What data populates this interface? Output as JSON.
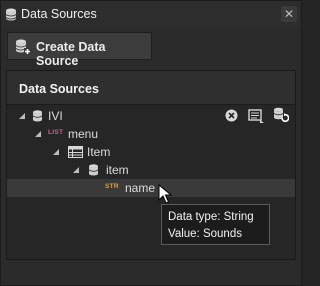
{
  "window": {
    "title": "Data Sources",
    "close_glyph": "✕"
  },
  "toolbar": {
    "create_label": "Create Data Source",
    "create_icon": "database-add-icon"
  },
  "panel": {
    "header": "Data Sources",
    "tree": [
      {
        "label": "IVI",
        "tag": "",
        "icon": "database-icon",
        "depth": 0
      },
      {
        "label": "menu",
        "tag": "LIST",
        "icon": "list-icon",
        "depth": 1
      },
      {
        "label": "Item",
        "tag": "",
        "icon": "table-icon",
        "depth": 2
      },
      {
        "label": "item",
        "tag": "",
        "icon": "database-icon",
        "depth": 3
      },
      {
        "label": "name",
        "tag": "STR",
        "icon": "string-icon",
        "depth": 4,
        "selected": true
      }
    ],
    "row_actions": [
      "remove-icon",
      "import-icon",
      "refresh-icon"
    ]
  },
  "tooltip": {
    "line1_key": "Data type:",
    "line1_value": "String",
    "line2_key": "Value:",
    "line2_value": "Sounds"
  },
  "colors": {
    "background": "#2b2b2b",
    "list_tag": "#e05a9a",
    "str_tag": "#e3a33a"
  }
}
